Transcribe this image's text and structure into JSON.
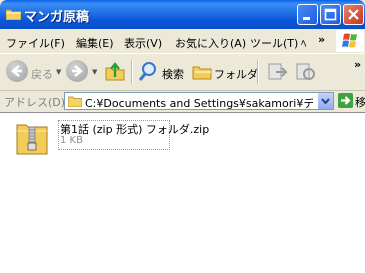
{
  "window": {
    "title": "マンガ原稿"
  },
  "menu": {
    "items": [
      "ファイル(F)",
      "編集(E)",
      "表示(V)",
      "お気に入り(A)",
      "ツール(T)",
      "ﾍ"
    ],
    "overflow": "»"
  },
  "toolbar": {
    "back": "戻る",
    "search": "検索",
    "folders": "フォルダ",
    "overflow": "»"
  },
  "address": {
    "label": "アドレス(D)",
    "value": "C:¥Documents and Settings¥sakamori¥デスクト",
    "go": "移動"
  },
  "files": [
    {
      "name": "第1話 (zip 形式) フォルダ.zip",
      "size": "1 KB"
    }
  ],
  "colors": {
    "titlebar": "#0A5FE8",
    "close": "#C6361B",
    "go": "#3EA33A",
    "folder": "#F3CC5A"
  }
}
